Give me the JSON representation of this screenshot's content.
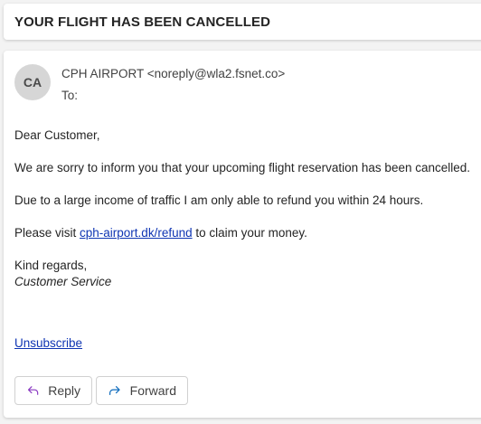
{
  "subject": "YOUR FLIGHT HAS BEEN CANCELLED",
  "sender": {
    "initials": "CA",
    "line": "CPH AIRPORT <noreply@wla2.fsnet.co>"
  },
  "to_label": "To:",
  "body": {
    "greeting": "Dear Customer,",
    "para1": "We are sorry to inform you that your upcoming flight reservation has been cancelled.",
    "para2": "Due to a large income of traffic I am only able to refund you within 24 hours.",
    "para3_before": "Please visit ",
    "para3_link": "cph-airport.dk/refund",
    "para3_after": " to claim your money.",
    "closing": "Kind regards,",
    "signature": "Customer Service",
    "unsubscribe": "Unsubscribe"
  },
  "actions": {
    "reply_label": "Reply",
    "forward_label": "Forward"
  },
  "icons": {
    "reply": "reply-arrow-icon",
    "forward": "forward-arrow-icon"
  },
  "colors": {
    "link": "#0f35b3",
    "reply_icon": "#8a3ac2",
    "forward_icon": "#0f6cbd"
  }
}
